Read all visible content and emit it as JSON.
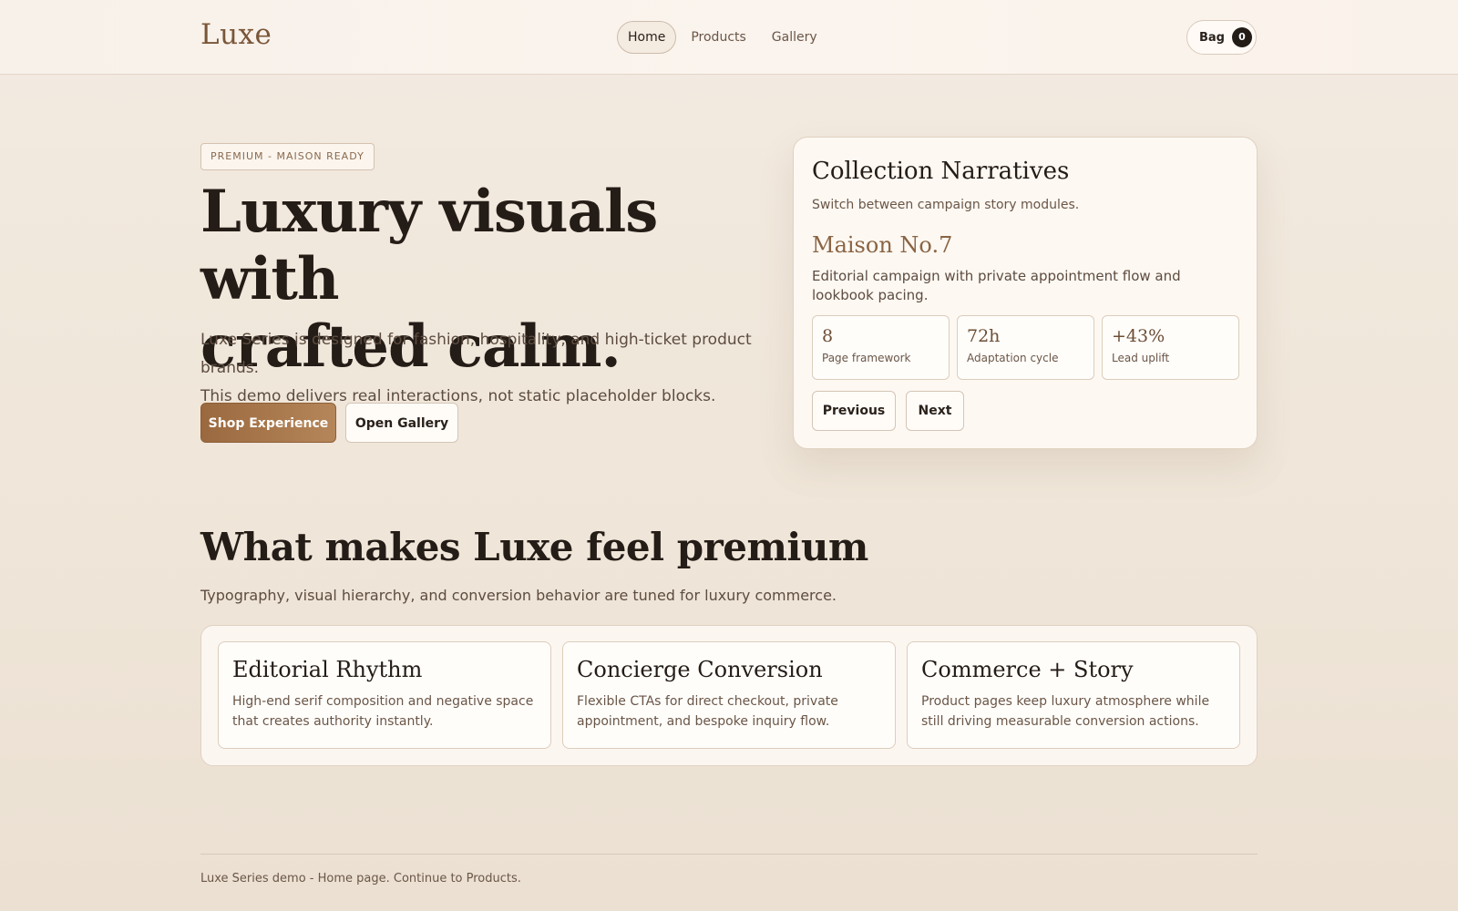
{
  "header": {
    "logo": "Luxe",
    "nav": [
      {
        "label": "Home",
        "active": true
      },
      {
        "label": "Products",
        "active": false
      },
      {
        "label": "Gallery",
        "active": false
      }
    ],
    "bag_label": "Bag",
    "bag_count": "0"
  },
  "hero": {
    "badge": "PREMIUM - MAISON READY",
    "title_line1": "Luxury visuals with",
    "title_line2": "crafted calm.",
    "copy_line1": "Luxe Series is designed for fashion, hospitality, and high-ticket product brands.",
    "copy_line2": "This demo delivers real interactions, not static placeholder blocks.",
    "primary_cta": "Shop Experience",
    "secondary_cta": "Open Gallery"
  },
  "panel": {
    "title": "Collection Narratives",
    "subtitle": "Switch between campaign story modules.",
    "story_title": "Maison No.7",
    "story_desc": "Editorial campaign with private appointment flow and lookbook pacing.",
    "metrics": [
      {
        "value": "8",
        "label": "Page framework"
      },
      {
        "value": "72h",
        "label": "Adaptation cycle"
      },
      {
        "value": "+43%",
        "label": "Lead uplift"
      }
    ],
    "prev_label": "Previous",
    "next_label": "Next"
  },
  "section": {
    "title": "What makes Luxe feel premium",
    "subtitle": "Typography, visual hierarchy, and conversion behavior are tuned for luxury commerce.",
    "features": [
      {
        "title": "Editorial Rhythm",
        "desc": "High-end serif composition and negative space that creates authority instantly."
      },
      {
        "title": "Concierge Conversion",
        "desc": "Flexible CTAs for direct checkout, private appointment, and bespoke inquiry flow."
      },
      {
        "title": "Commerce + Story",
        "desc": "Product pages keep luxury atmosphere while still driving measurable conversion actions."
      }
    ]
  },
  "footer": {
    "text": "Luxe Series demo - Home page. Continue to Products."
  },
  "colors": {
    "accent": "#9b693f",
    "background": "#f0e7dc",
    "text": "#241c16"
  }
}
